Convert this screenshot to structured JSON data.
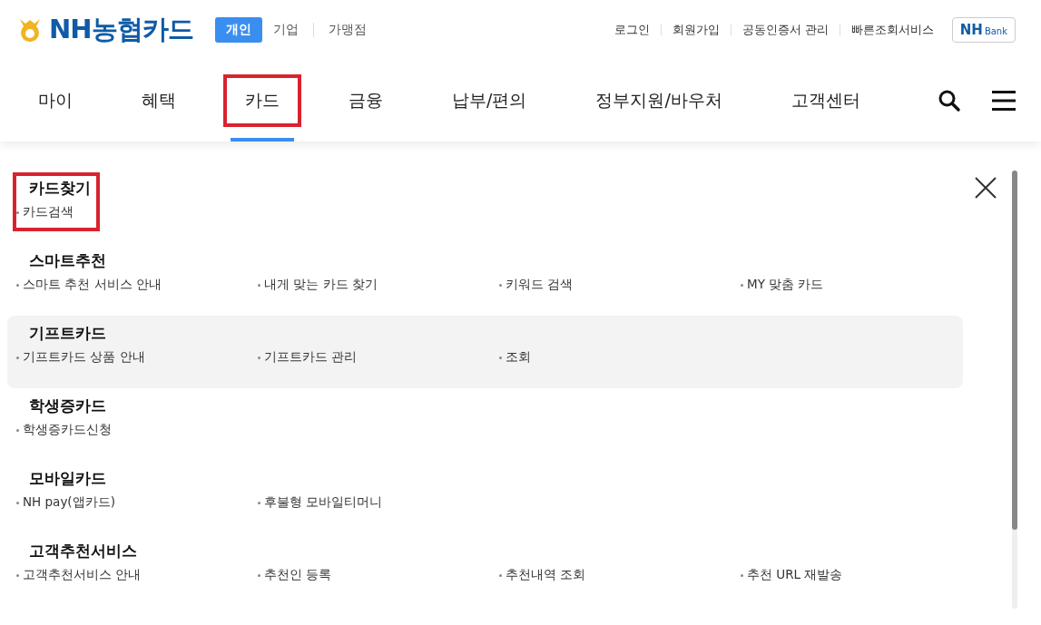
{
  "logo": {
    "text": "NH농협카드"
  },
  "segments": [
    {
      "label": "개인",
      "selected": true
    },
    {
      "label": "기업",
      "selected": false
    },
    {
      "label": "가맹점",
      "selected": false
    }
  ],
  "util_links": [
    "로그인",
    "회원가입",
    "공동인증서 관리",
    "빠른조회서비스"
  ],
  "bank_button": {
    "brand": "NH",
    "label": "Bank"
  },
  "nav": [
    {
      "label": "마이",
      "selected": false,
      "highlighted": false
    },
    {
      "label": "혜택",
      "selected": false,
      "highlighted": false
    },
    {
      "label": "카드",
      "selected": true,
      "highlighted": true
    },
    {
      "label": "금융",
      "selected": false,
      "highlighted": false
    },
    {
      "label": "납부/편의",
      "selected": false,
      "highlighted": false
    },
    {
      "label": "정부지원/바우처",
      "selected": false,
      "highlighted": false
    },
    {
      "label": "고객센터",
      "selected": false,
      "highlighted": false
    }
  ],
  "menu": {
    "sections": [
      {
        "title": "카드찾기",
        "highlighted": true,
        "hovered": false,
        "links": [
          "카드검색"
        ]
      },
      {
        "title": "스마트추천",
        "highlighted": false,
        "hovered": false,
        "links": [
          "스마트 추천 서비스 안내",
          "내게 맞는 카드 찾기",
          "키워드 검색",
          "MY 맞춤 카드"
        ]
      },
      {
        "title": "기프트카드",
        "highlighted": false,
        "hovered": true,
        "links": [
          "기프트카드 상품 안내",
          "기프트카드 관리",
          "조회"
        ]
      },
      {
        "title": "학생증카드",
        "highlighted": false,
        "hovered": false,
        "links": [
          "학생증카드신청"
        ]
      },
      {
        "title": "모바일카드",
        "highlighted": false,
        "hovered": false,
        "links": [
          "NH pay(앱카드)",
          "후불형 모바일티머니"
        ]
      },
      {
        "title": "고객추천서비스",
        "highlighted": false,
        "hovered": false,
        "links": [
          "고객추천서비스 안내",
          "추천인 등록",
          "추천내역 조회",
          "추천 URL 재발송"
        ]
      }
    ]
  }
}
